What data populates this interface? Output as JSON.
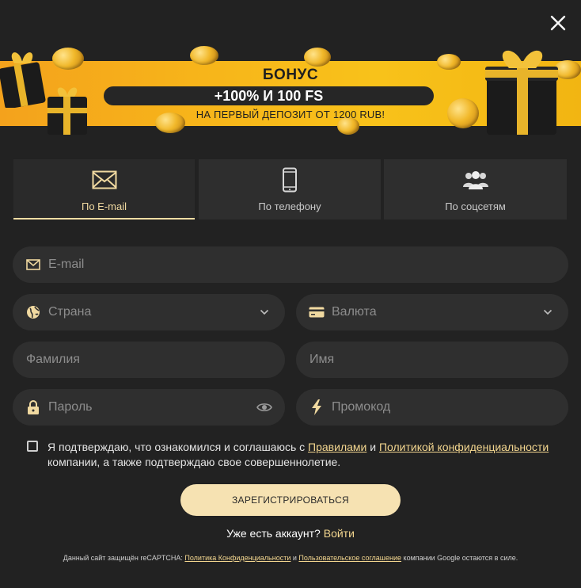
{
  "close": {
    "icon": "close-icon"
  },
  "banner": {
    "title": "БОНУС",
    "offer": "+100% И 100 FS",
    "subtitle": "НА ПЕРВЫЙ ДЕПОЗИТ ОТ 1200 RUB!"
  },
  "tabs": [
    {
      "label": "По E-mail",
      "icon": "envelope-icon",
      "active": true
    },
    {
      "label": "По телефону",
      "icon": "phone-icon",
      "active": false
    },
    {
      "label": "По соцсетям",
      "icon": "users-icon",
      "active": false
    }
  ],
  "form": {
    "email_placeholder": "E-mail",
    "country_placeholder": "Страна",
    "currency_placeholder": "Валюта",
    "lastname_placeholder": "Фамилия",
    "firstname_placeholder": "Имя",
    "password_placeholder": "Пароль",
    "promo_placeholder": "Промокод"
  },
  "terms": {
    "part1": "Я подтверждаю, что ознакомился и соглашаюсь с ",
    "rules_link": "Правилами",
    "part2": " и ",
    "privacy_link": "Политикой конфиденциальности",
    "part3": " компании, а также подтверждаю свое совершеннолетие."
  },
  "register_label": "ЗАРЕГИСТРИРОВАТЬСЯ",
  "login": {
    "text": "Уже есть аккаунт? ",
    "link": "Войти"
  },
  "footer": {
    "part1": "Данный сайт защищён reCAPTCHA: ",
    "privacy_link": "Политика Конфиденциальности",
    "part2": " и ",
    "terms_link": "Пользовательское соглашение",
    "part3": " компании Google остаются в силе."
  },
  "colors": {
    "accent": "#f3d68f",
    "background": "#222222",
    "field": "#2f2f2f",
    "banner": "#f7b51a"
  }
}
